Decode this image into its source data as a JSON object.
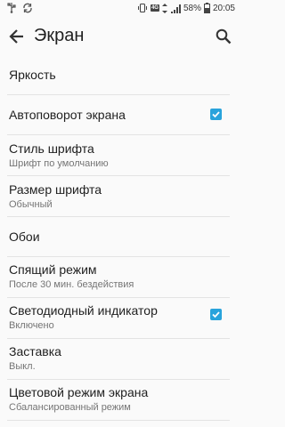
{
  "status_bar": {
    "battery": "58%",
    "time": "20:05",
    "network_badge": "4G",
    "icons": [
      "usb-icon",
      "sync-icon",
      "vibrate-icon",
      "signal-icon",
      "battery-icon"
    ]
  },
  "header": {
    "title": "Экран",
    "back_icon": "arrow-back-icon",
    "search_icon": "search-icon"
  },
  "settings": [
    {
      "label": "Яркость",
      "sub": "",
      "checkbox": false
    },
    {
      "label": "Автоповорот экрана",
      "sub": "",
      "checkbox": true,
      "checked": true
    },
    {
      "label": "Стиль шрифта",
      "sub": "Шрифт по умолчанию",
      "checkbox": false
    },
    {
      "label": "Размер шрифта",
      "sub": "Обычный",
      "checkbox": false
    },
    {
      "label": "Обои",
      "sub": "",
      "checkbox": false
    },
    {
      "label": "Спящий режим",
      "sub": "После 30 мин. бездействия",
      "checkbox": false
    },
    {
      "label": "Светодиодный индикатор",
      "sub": "Включено",
      "checkbox": true,
      "checked": true
    },
    {
      "label": "Заставка",
      "sub": "Выкл.",
      "checkbox": false
    },
    {
      "label": "Цветовой режим экрана",
      "sub": "Сбалансированный режим",
      "checkbox": false
    }
  ],
  "colors": {
    "accent": "#29a3dc",
    "background": "#fafafa",
    "primary_text": "#212121",
    "secondary_text": "#757575"
  }
}
